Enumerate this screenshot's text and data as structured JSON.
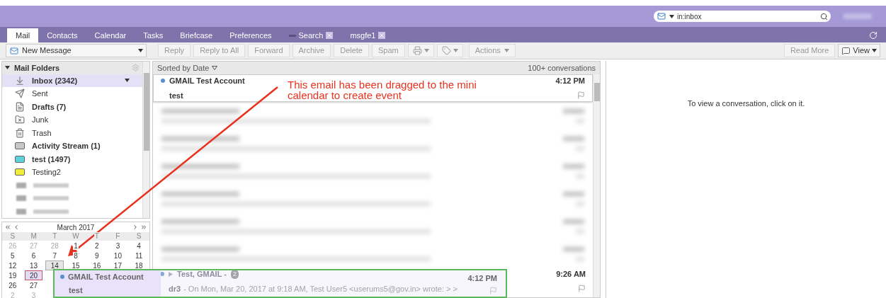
{
  "search": {
    "value": "in:inbox"
  },
  "tabs": [
    {
      "label": "Mail",
      "selected": true,
      "closable": false,
      "kind": "plain"
    },
    {
      "label": "Contacts",
      "selected": false,
      "closable": false,
      "kind": "plain"
    },
    {
      "label": "Calendar",
      "selected": false,
      "closable": false,
      "kind": "plain"
    },
    {
      "label": "Tasks",
      "selected": false,
      "closable": false,
      "kind": "plain"
    },
    {
      "label": "Briefcase",
      "selected": false,
      "closable": false,
      "kind": "plain"
    },
    {
      "label": "Preferences",
      "selected": false,
      "closable": false,
      "kind": "plain"
    },
    {
      "label": "Search",
      "selected": false,
      "closable": true,
      "kind": "search"
    },
    {
      "label": "msgfe1",
      "selected": false,
      "closable": true,
      "kind": "plain"
    }
  ],
  "toolbar": {
    "new_message": "New Message",
    "buttons": [
      {
        "label": "Reply",
        "disabled": true
      },
      {
        "label": "Reply to All",
        "disabled": true
      },
      {
        "label": "Forward",
        "disabled": true
      },
      {
        "label": "Archive",
        "disabled": true
      },
      {
        "label": "Delete",
        "disabled": true
      },
      {
        "label": "Spam",
        "disabled": true
      }
    ],
    "actions": "Actions",
    "read_more": "Read More",
    "view": "View"
  },
  "folders": {
    "title": "Mail Folders",
    "expanded": true,
    "items": [
      {
        "kind": "inbox",
        "label": "Inbox (2342)",
        "bold": true,
        "selected": true
      },
      {
        "kind": "sent",
        "label": "Sent",
        "bold": false,
        "selected": false
      },
      {
        "kind": "drafts",
        "label": "Drafts (7)",
        "bold": true,
        "selected": false
      },
      {
        "kind": "junk",
        "label": "Junk",
        "bold": false,
        "selected": false
      },
      {
        "kind": "trash",
        "label": "Trash",
        "bold": false,
        "selected": false
      },
      {
        "kind": "folder",
        "label": "Activity Stream (1)",
        "bold": true,
        "selected": false,
        "color": "#c8c8c8"
      },
      {
        "kind": "folder",
        "label": "test (1497)",
        "bold": true,
        "selected": false,
        "color": "#5fd3dc"
      },
      {
        "kind": "folder",
        "label": "Testing2",
        "bold": false,
        "selected": false,
        "color": "#f2ec3a"
      },
      {
        "kind": "blurred"
      },
      {
        "kind": "blurred"
      },
      {
        "kind": "blurred"
      }
    ]
  },
  "calendar": {
    "month": "March 2017",
    "weekdays": [
      "S",
      "M",
      "T",
      "W",
      "T",
      "F",
      "S"
    ],
    "weeks": [
      [
        {
          "d": "26",
          "muted": true,
          "selected": false,
          "hover": false
        },
        {
          "d": "27",
          "muted": true,
          "selected": false,
          "hover": false
        },
        {
          "d": "28",
          "muted": true,
          "selected": false,
          "hover": false
        },
        {
          "d": "1",
          "muted": false,
          "selected": false,
          "hover": false
        },
        {
          "d": "2",
          "muted": false,
          "selected": false,
          "hover": false
        },
        {
          "d": "3",
          "muted": false,
          "selected": false,
          "hover": false
        },
        {
          "d": "4",
          "muted": false,
          "selected": false,
          "hover": false
        }
      ],
      [
        {
          "d": "5",
          "muted": false,
          "selected": false,
          "hover": false
        },
        {
          "d": "6",
          "muted": false,
          "selected": false,
          "hover": false
        },
        {
          "d": "7",
          "muted": false,
          "selected": false,
          "hover": false
        },
        {
          "d": "8",
          "muted": false,
          "selected": false,
          "hover": false
        },
        {
          "d": "9",
          "muted": false,
          "selected": false,
          "hover": false
        },
        {
          "d": "10",
          "muted": false,
          "selected": false,
          "hover": false
        },
        {
          "d": "11",
          "muted": false,
          "selected": false,
          "hover": false
        }
      ],
      [
        {
          "d": "12",
          "muted": false,
          "selected": false,
          "hover": false
        },
        {
          "d": "13",
          "muted": false,
          "selected": false,
          "hover": false
        },
        {
          "d": "14",
          "muted": false,
          "selected": false,
          "hover": true
        },
        {
          "d": "15",
          "muted": false,
          "selected": false,
          "hover": false
        },
        {
          "d": "16",
          "muted": false,
          "selected": false,
          "hover": false
        },
        {
          "d": "17",
          "muted": false,
          "selected": false,
          "hover": false
        },
        {
          "d": "18",
          "muted": false,
          "selected": false,
          "hover": false
        }
      ],
      [
        {
          "d": "19",
          "muted": false,
          "selected": false,
          "hover": false
        },
        {
          "d": "20",
          "muted": false,
          "selected": true,
          "hover": false
        }
      ],
      [
        {
          "d": "26",
          "muted": false,
          "selected": false,
          "hover": false
        },
        {
          "d": "27",
          "muted": false,
          "selected": false,
          "hover": false
        }
      ],
      [
        {
          "d": "2",
          "muted": true,
          "selected": false,
          "hover": false
        },
        {
          "d": "3",
          "muted": true,
          "selected": false,
          "hover": false
        }
      ]
    ]
  },
  "list": {
    "sort": "Sorted by Date",
    "count": "100+ conversations",
    "rows": [
      {
        "kind": "message",
        "selected": true,
        "sender": "GMAIL Test Account",
        "subject": "test",
        "time": "4:12 PM"
      },
      {
        "kind": "blurred"
      },
      {
        "kind": "blurred"
      },
      {
        "kind": "blurred"
      },
      {
        "kind": "blurred"
      },
      {
        "kind": "blurred"
      },
      {
        "kind": "blurred"
      },
      {
        "kind": "conversation",
        "selected": false,
        "sender": "Test, GMAIL -",
        "count": "2",
        "subject": "dr3",
        "snippet": "- On Mon, Mar 20, 2017 at 9:18 AM, Test User5 <userums5@gov.in> wrote: > >",
        "time": "9:26 AM"
      }
    ]
  },
  "reading_pane": {
    "message": "To view a conversation, click on it."
  },
  "drag_ghost": {
    "sender": "GMAIL Test Account",
    "subject": "test",
    "time": "4:12 PM"
  },
  "annotation": {
    "text": "This email has been dragged to the mini calendar to create event"
  }
}
